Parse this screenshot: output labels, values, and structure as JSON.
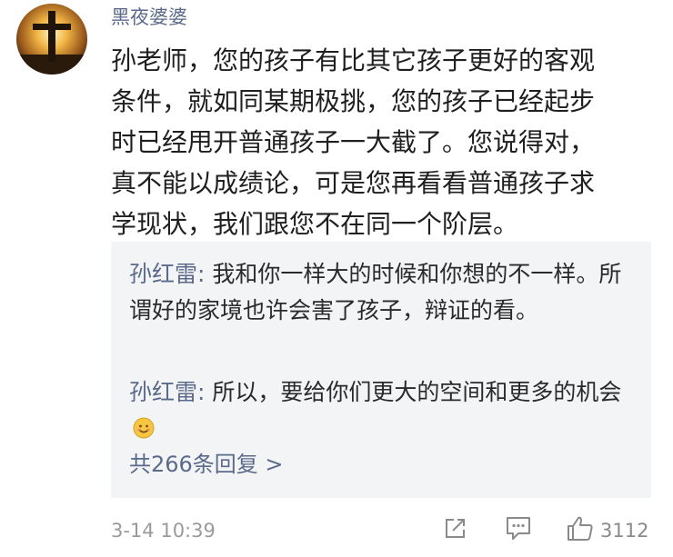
{
  "comment": {
    "username": "黑夜婆婆",
    "text": "孙老师，您的孩子有比其它孩子更好的客观\n条件，就如同某期极挑，您的孩子已经起步\n时已经甩开普通孩子一大截了。您说得对，\n真不能以成绩论，可是您再看看普通孩子求\n学现状，我们跟您不在同一个阶层。",
    "timestamp": "3-14 10:39",
    "like_count": "3112",
    "avatar_icon": "cross-sunset-avatar",
    "share_icon": "share-icon",
    "comment_icon": "comment-icon",
    "like_icon": "thumbs-up-icon"
  },
  "replies": {
    "items": [
      {
        "author": "孙红雷:",
        "text": " 我和你一样大的时候和你想的不一样。所谓好的家境也许会害了孩子，辩证的看。"
      },
      {
        "author": "孙红雷:",
        "text": " 所以，要给你们更大的空间和更多的机会",
        "emoji": "smile-emoji"
      }
    ],
    "more_label": "共266条回复 >"
  },
  "colors": {
    "name_blue": "#5b6a8a",
    "reply_bg": "#f3f4f6",
    "meta_gray": "#9a9a9a"
  }
}
